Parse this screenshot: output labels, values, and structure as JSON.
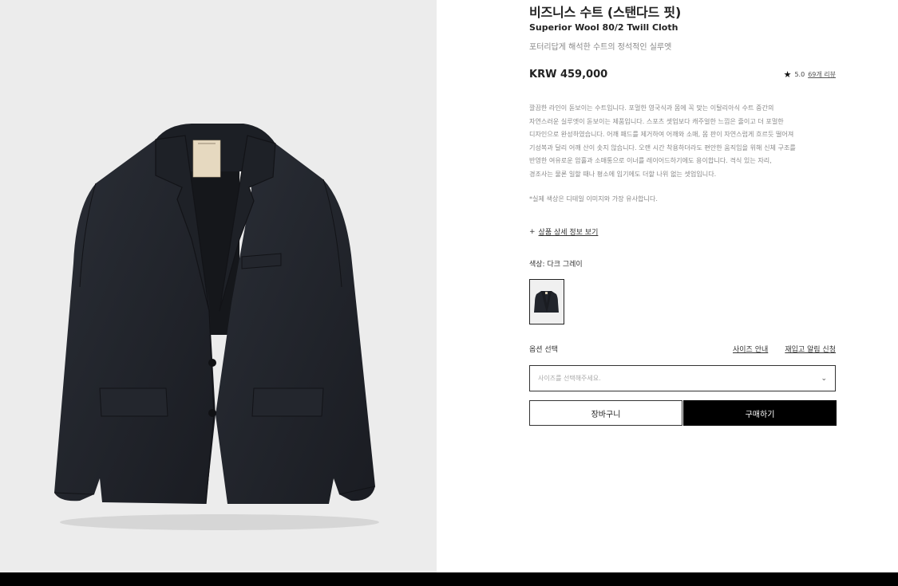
{
  "product": {
    "title": "비즈니스 수트 (스탠다드 핏)",
    "subtitle": "Superior Wool 80/2 Twill Cloth",
    "tagline": "포터리답게 해석한 수트의 정석적인 실루엣",
    "price": "KRW 459,000",
    "rating": "5.0",
    "reviews": "69개 리뷰",
    "description": [
      "깔끔한 라인이 돋보이는 수트입니다. 포멀한 영국식과 몸에 꼭 맞는 이탈리아식 수트 중간의",
      "자연스러운 실루엣이 돋보이는 제품입니다. 스포츠 셋업보다 캐주얼한 느낌은 줄이고 더 포멀한",
      "디자인으로 완성하였습니다. 어깨 패드를 제거하여 어깨와 소매, 몸 판이 자연스럽게 흐르듯 떨어져",
      "기성복과 달리 어깨 산이 솟지 않습니다. 오랜 시간 착용하더라도 편안한 움직임을 위해 신체 구조를",
      "반영한 여유로운 암홀과 소매통으로 이너를 레이어드하기에도 용이합니다. 격식 있는 자리,",
      "경조사는 물론 일할 때나 평소에 입기에도 더할 나위 없는 셋업입니다."
    ],
    "note": "*실제 색상은 디테일 이미지와 가장 유사합니다.",
    "detail_link": "상품 상세 정보 보기",
    "color_label": "색상: 다크 그레이",
    "option_label": "옵션 선택",
    "size_guide": "사이즈 안내",
    "restock": "재입고 알림 신청",
    "select_placeholder": "사이즈를 선택해주세요.",
    "cart_button": "장바구니",
    "buy_button": "구매하기"
  },
  "icons": {
    "star": "star-icon",
    "plus": "plus-icon",
    "chevron": "chevron-down-icon"
  },
  "colors": {
    "jacket": "#22252c",
    "image_bg": "#ececec",
    "buy_button": "#000000"
  }
}
